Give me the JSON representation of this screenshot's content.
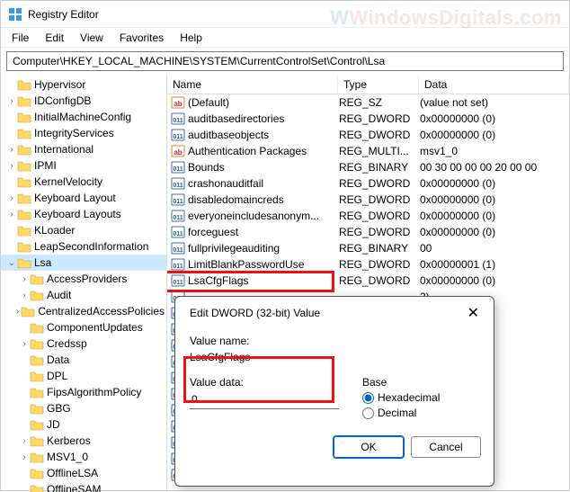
{
  "window": {
    "title": "Registry Editor"
  },
  "menubar": [
    "File",
    "Edit",
    "View",
    "Favorites",
    "Help"
  ],
  "address": "Computer\\HKEY_LOCAL_MACHINE\\SYSTEM\\CurrentControlSet\\Control\\Lsa",
  "watermark": "WindowsDigitals.com",
  "tree": [
    {
      "label": "Hypervisor",
      "indent": 0,
      "exp": ""
    },
    {
      "label": "IDConfigDB",
      "indent": 0,
      "exp": ">"
    },
    {
      "label": "InitialMachineConfig",
      "indent": 0,
      "exp": ""
    },
    {
      "label": "IntegrityServices",
      "indent": 0,
      "exp": ""
    },
    {
      "label": "International",
      "indent": 0,
      "exp": ">"
    },
    {
      "label": "IPMI",
      "indent": 0,
      "exp": ">"
    },
    {
      "label": "KernelVelocity",
      "indent": 0,
      "exp": ""
    },
    {
      "label": "Keyboard Layout",
      "indent": 0,
      "exp": ">"
    },
    {
      "label": "Keyboard Layouts",
      "indent": 0,
      "exp": ">"
    },
    {
      "label": "KLoader",
      "indent": 0,
      "exp": ""
    },
    {
      "label": "LeapSecondInformation",
      "indent": 0,
      "exp": ""
    },
    {
      "label": "Lsa",
      "indent": 0,
      "exp": "v",
      "selected": true
    },
    {
      "label": "AccessProviders",
      "indent": 1,
      "exp": ">"
    },
    {
      "label": "Audit",
      "indent": 1,
      "exp": ">"
    },
    {
      "label": "CentralizedAccessPolicies",
      "indent": 1,
      "exp": ">"
    },
    {
      "label": "ComponentUpdates",
      "indent": 1,
      "exp": ""
    },
    {
      "label": "Credssp",
      "indent": 1,
      "exp": ">"
    },
    {
      "label": "Data",
      "indent": 1,
      "exp": ""
    },
    {
      "label": "DPL",
      "indent": 1,
      "exp": ""
    },
    {
      "label": "FipsAlgorithmPolicy",
      "indent": 1,
      "exp": ""
    },
    {
      "label": "GBG",
      "indent": 1,
      "exp": ""
    },
    {
      "label": "JD",
      "indent": 1,
      "exp": ""
    },
    {
      "label": "Kerberos",
      "indent": 1,
      "exp": ">"
    },
    {
      "label": "MSV1_0",
      "indent": 1,
      "exp": ">"
    },
    {
      "label": "OfflineLSA",
      "indent": 1,
      "exp": ""
    },
    {
      "label": "OfflineSAM",
      "indent": 1,
      "exp": ""
    }
  ],
  "columns": {
    "name": "Name",
    "type": "Type",
    "data": "Data"
  },
  "values": [
    {
      "icon": "str",
      "name": "(Default)",
      "type": "REG_SZ",
      "data": "(value not set)"
    },
    {
      "icon": "bin",
      "name": "auditbasedirectories",
      "type": "REG_DWORD",
      "data": "0x00000000 (0)"
    },
    {
      "icon": "bin",
      "name": "auditbaseobjects",
      "type": "REG_DWORD",
      "data": "0x00000000 (0)"
    },
    {
      "icon": "str",
      "name": "Authentication Packages",
      "type": "REG_MULTI...",
      "data": "msv1_0"
    },
    {
      "icon": "bin",
      "name": "Bounds",
      "type": "REG_BINARY",
      "data": "00 30 00 00 00 20 00 00"
    },
    {
      "icon": "bin",
      "name": "crashonauditfail",
      "type": "REG_DWORD",
      "data": "0x00000000 (0)"
    },
    {
      "icon": "bin",
      "name": "disabledomaincreds",
      "type": "REG_DWORD",
      "data": "0x00000000 (0)"
    },
    {
      "icon": "bin",
      "name": "everyoneincludesanonym...",
      "type": "REG_DWORD",
      "data": "0x00000000 (0)"
    },
    {
      "icon": "bin",
      "name": "forceguest",
      "type": "REG_DWORD",
      "data": "0x00000000 (0)"
    },
    {
      "icon": "bin",
      "name": "fullprivilegeauditing",
      "type": "REG_BINARY",
      "data": "00"
    },
    {
      "icon": "bin",
      "name": "LimitBlankPasswordUse",
      "type": "REG_DWORD",
      "data": "0x00000001 (1)"
    },
    {
      "icon": "bin",
      "name": "LsaCfgFlags",
      "type": "REG_DWORD",
      "data": "0x00000000 (0)"
    },
    {
      "icon": "bin",
      "name": "",
      "type": "",
      "data": "2)"
    },
    {
      "icon": "bin",
      "name": "",
      "type": "",
      "data": ""
    },
    {
      "icon": "bin",
      "name": "",
      "type": "",
      "data": ""
    },
    {
      "icon": "bin",
      "name": "",
      "type": "",
      "data": ""
    },
    {
      "icon": "bin",
      "name": "",
      "type": "",
      "data": ""
    },
    {
      "icon": "bin",
      "name": "",
      "type": "",
      "data": ""
    },
    {
      "icon": "bin",
      "name": "",
      "type": "",
      "data": ""
    },
    {
      "icon": "bin",
      "name": "",
      "type": "",
      "data": ""
    },
    {
      "icon": "bin",
      "name": "",
      "type": "",
      "data": ""
    },
    {
      "icon": "bin",
      "name": "",
      "type": "",
      "data": ""
    },
    {
      "icon": "bin",
      "name": "",
      "type": "",
      "data": ""
    },
    {
      "icon": "bin",
      "name": "",
      "type": "",
      "data": ""
    }
  ],
  "dialog": {
    "title": "Edit DWORD (32-bit) Value",
    "valueNameLabel": "Value name:",
    "valueName": "LsaCfgFlags",
    "valueDataLabel": "Value data:",
    "valueData": "0",
    "baseLabel": "Base",
    "hexLabel": "Hexadecimal",
    "decLabel": "Decimal",
    "ok": "OK",
    "cancel": "Cancel"
  }
}
